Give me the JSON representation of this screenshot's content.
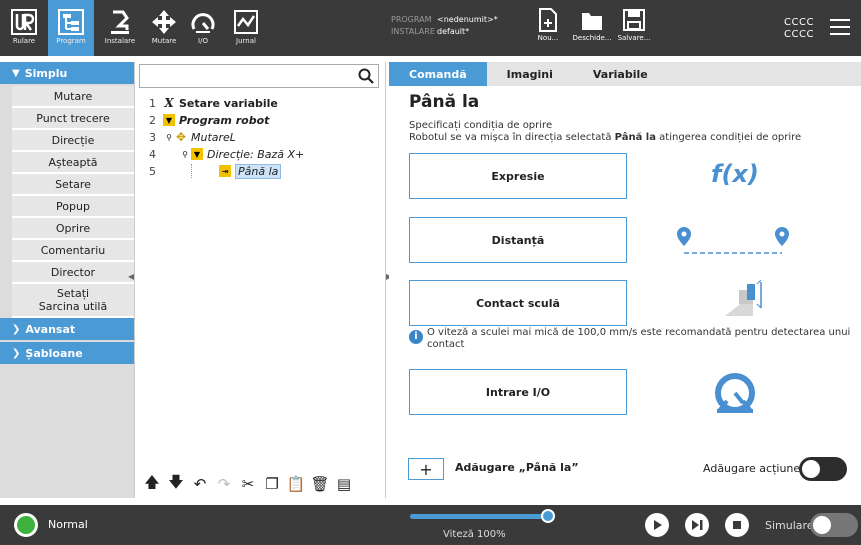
{
  "header": {
    "nav": [
      {
        "id": "ur",
        "label": "Rulare",
        "icon": "ur-logo-icon"
      },
      {
        "id": "program",
        "label": "Program",
        "icon": "program-tree-icon",
        "active": true
      },
      {
        "id": "installation",
        "label": "Instalare",
        "icon": "robot-arm-icon"
      },
      {
        "id": "move",
        "label": "Mutare",
        "icon": "move-arrows-icon"
      },
      {
        "id": "io",
        "label": "I/O",
        "icon": "io-gauge-icon"
      },
      {
        "id": "log",
        "label": "Jurnal",
        "icon": "log-chart-icon"
      }
    ],
    "program_key": "PROGRAM",
    "program_value": "<nedenumit>*",
    "installation_key": "INSTALARE",
    "installation_value": "default*",
    "file_buttons": [
      {
        "label": "Nou...",
        "icon": "new-file-icon"
      },
      {
        "label": "Deschide...",
        "icon": "open-folder-icon"
      },
      {
        "label": "Salvare...",
        "icon": "save-disk-icon"
      }
    ],
    "cccc_line1": "CCCC",
    "cccc_line2": "CCCC"
  },
  "sidebar": {
    "category_simple": "Simplu",
    "items": [
      "Mutare",
      "Punct trecere",
      "Direcție",
      "Așteaptă",
      "Setare",
      "Popup",
      "Oprire",
      "Comentariu",
      "Director"
    ],
    "item_payload_line1": "Setați",
    "item_payload_line2": "Sarcina utilă",
    "category_advanced": "Avansat",
    "category_templates": "Șabloane"
  },
  "tree": {
    "search_placeholder": "",
    "rows": [
      {
        "num": "1",
        "text": "Setare variabile"
      },
      {
        "num": "2",
        "text": "Program robot"
      },
      {
        "num": "3",
        "text": "MutareL"
      },
      {
        "num": "4",
        "text": "Direcție: Bază X+"
      },
      {
        "num": "5",
        "text": "Până la"
      }
    ]
  },
  "right": {
    "tabs": [
      "Comandă",
      "Imagini",
      "Variabile"
    ],
    "title": "Până la",
    "desc_line1": "Specificați condiția de oprire",
    "desc_line2_a": "Robotul se va mișca în direcția selectată ",
    "desc_line2_b": "Până la",
    "desc_line2_c": " atingerea condiției de oprire",
    "buttons": [
      "Expresie",
      "Distanță",
      "Contact sculă",
      "Intrare I/O"
    ],
    "fx": "f(x)",
    "info": "O viteză a sculei mai mică de 100,0 mm/s este recomandată pentru detectarea unui contact",
    "add_symbol": "+",
    "add_label": "Adăugare „Până la”",
    "action_label": "Adăugare acțiune"
  },
  "footer": {
    "status": "Normal",
    "speed_label": "Viteză 100%",
    "speed_percent": 100,
    "simulation_label": "Simulare"
  },
  "colors": {
    "accent": "#4a9ad6",
    "header_bg": "#3a3a3a",
    "status_ok": "#3db23d",
    "highlight": "#f2c200"
  }
}
